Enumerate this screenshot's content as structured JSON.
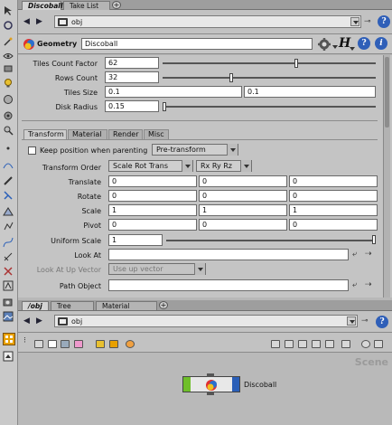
{
  "tabs_top": [
    {
      "label": "Discoball",
      "active": true
    },
    {
      "label": "Take List",
      "active": false
    }
  ],
  "path_top": {
    "value": "obj"
  },
  "node": {
    "type_label": "Geometry",
    "name": "Discoball"
  },
  "params": {
    "tiles_count_factor": {
      "label": "Tiles Count Factor",
      "value": "62",
      "slider_fraction": 0.6
    },
    "rows_count": {
      "label": "Rows Count",
      "value": "32",
      "slider_fraction": 0.32
    },
    "tiles_size": {
      "label": "Tiles Size",
      "value_x": "0.1",
      "value_y": "0.1"
    },
    "disk_radius": {
      "label": "Disk Radius",
      "value": "0.15",
      "slider_fraction": 0.02
    }
  },
  "param_tabs": [
    "Transform",
    "Material",
    "Render",
    "Misc"
  ],
  "transform": {
    "keep_position_label": "Keep position when parenting",
    "keep_position_menu": "Pre-transform",
    "transform_order_label": "Transform Order",
    "transform_order_value": "Scale Rot Trans",
    "rotate_order_value": "Rx Ry Rz",
    "rows": [
      {
        "label": "Translate",
        "x": "0",
        "y": "0",
        "z": "0"
      },
      {
        "label": "Rotate",
        "x": "0",
        "y": "0",
        "z": "0"
      },
      {
        "label": "Scale",
        "x": "1",
        "y": "1",
        "z": "1"
      },
      {
        "label": "Pivot",
        "x": "0",
        "y": "0",
        "z": "0"
      }
    ],
    "uniform_scale_label": "Uniform Scale",
    "uniform_scale_value": "1",
    "uniform_scale_fraction": 1.0,
    "look_at_label": "Look At",
    "look_at_value": "",
    "look_at_up_label": "Look At Up Vector",
    "look_at_up_value": "Use up vector",
    "path_object_label": "Path Object",
    "path_object_value": ""
  },
  "tabs_bottom": [
    {
      "label": "/obj",
      "active": true
    },
    {
      "label": "Tree View",
      "active": false
    },
    {
      "label": "Material Palette",
      "active": false
    }
  ],
  "path_bottom": {
    "value": "obj"
  },
  "network": {
    "context_label": "Scene",
    "node_name": "Discoball"
  },
  "colors": {
    "node_green": "#6fbf2a",
    "node_blue": "#2a5fb8",
    "help_blue": "#2f5fb8"
  }
}
